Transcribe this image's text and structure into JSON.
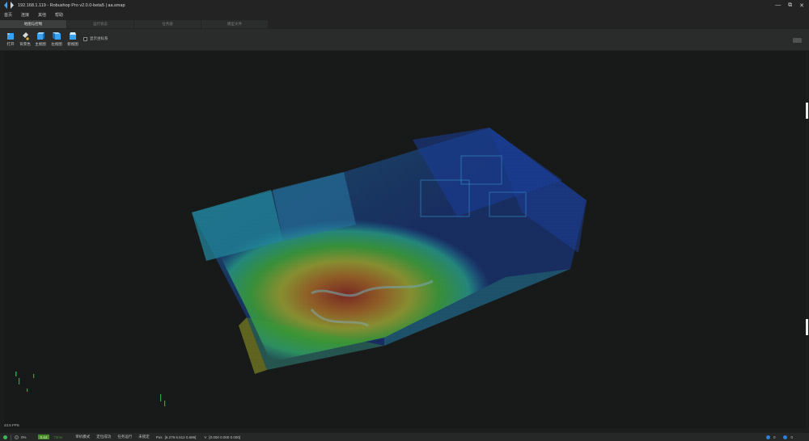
{
  "window": {
    "title": "192.168.1.119 - Robushop Pro v2.0.0-beta5 | aa.smap",
    "controls": [
      "—",
      "⧉",
      "✕"
    ]
  },
  "menu": [
    "首页",
    "连接",
    "其他",
    "帮助"
  ],
  "tabs": [
    {
      "label": "地图与控制",
      "active": true
    },
    {
      "label": "运行状态",
      "active": false
    },
    {
      "label": "任务链",
      "active": false
    },
    {
      "label": "模型文件",
      "active": false
    }
  ],
  "toolbar": {
    "tools": [
      {
        "label": "打开",
        "icon": "folder-open-icon",
        "color": "#3aa0f0"
      },
      {
        "label": "背景色",
        "icon": "paint-bucket-icon",
        "color": "#e0b030"
      },
      {
        "label": "主视图",
        "icon": "main-view-cube-icon",
        "color": "#3aa0f0"
      },
      {
        "label": "左视图",
        "icon": "left-view-cube-icon",
        "color": "#3aa0f0"
      },
      {
        "label": "俯视图",
        "icon": "top-view-cube-icon",
        "color": "#3aa0f0"
      }
    ],
    "checkbox_label": "显示坐标系",
    "checkbox_checked": false
  },
  "viewport": {
    "fps": "43.5 FPS",
    "colors": [
      "#1b4fd8",
      "#1ea8e8",
      "#2ed0b0",
      "#4fe040",
      "#d8e030",
      "#e88a20",
      "#c03018"
    ]
  },
  "statusbar": {
    "percent": "0%",
    "speed_badge": "0.44",
    "speed_unit": "73ms",
    "mode": "单机模式",
    "locate": "定位成功",
    "task": "任务运行",
    "released": "未锁定",
    "pos_label": "Pos",
    "pos_value": "[6.279  6.512  0.686]",
    "v_label": "V",
    "v_value": "[0.000  0.000  0.000]",
    "msg_count_1": "0",
    "msg_count_2": "0"
  }
}
